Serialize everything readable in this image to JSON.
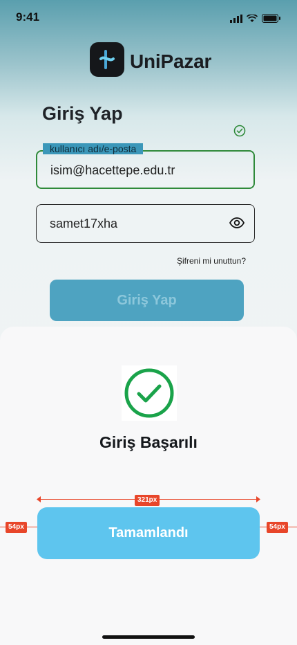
{
  "status_bar": {
    "time": "9:41"
  },
  "app": {
    "brand": "UniPazar"
  },
  "login": {
    "title": "Giriş Yap",
    "username_label": "kullanıcı adı/e-posta",
    "username_value": "isim@hacettepe.edu.tr",
    "password_value": "samet17xha",
    "forgot_link": "Şifreni mi unuttun?",
    "submit_label": "Giriş Yap"
  },
  "sheet": {
    "title": "Giriş Başarılı",
    "done_label": "Tamamlandı"
  },
  "measurements": {
    "width_tag": "321px",
    "left_margin_tag": "54px",
    "right_margin_tag": "54px"
  },
  "colors": {
    "primary": "#5ec5ee",
    "success": "#1aa34a",
    "redline": "#e8462a"
  }
}
